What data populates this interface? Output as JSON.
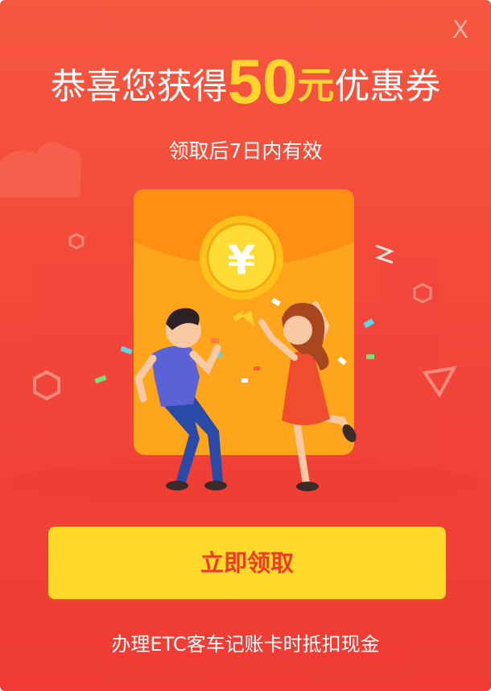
{
  "dialog": {
    "close_symbol": "X",
    "title_prefix": "恭喜您获得",
    "amount": "50",
    "unit": "元",
    "title_suffix": "优惠券",
    "subtitle": "领取后7日内有效",
    "coin_symbol": "¥",
    "cta_label": "立即领取",
    "footer_text": "办理ETC客车记账卡时抵扣现金"
  },
  "colors": {
    "background": "#f3473a",
    "accent_yellow": "#ffd82a",
    "cta_text": "#ee3b26",
    "envelope": "#ff9c1a"
  },
  "icons": {
    "close": "close-icon",
    "coin": "yuan-coin-icon"
  }
}
